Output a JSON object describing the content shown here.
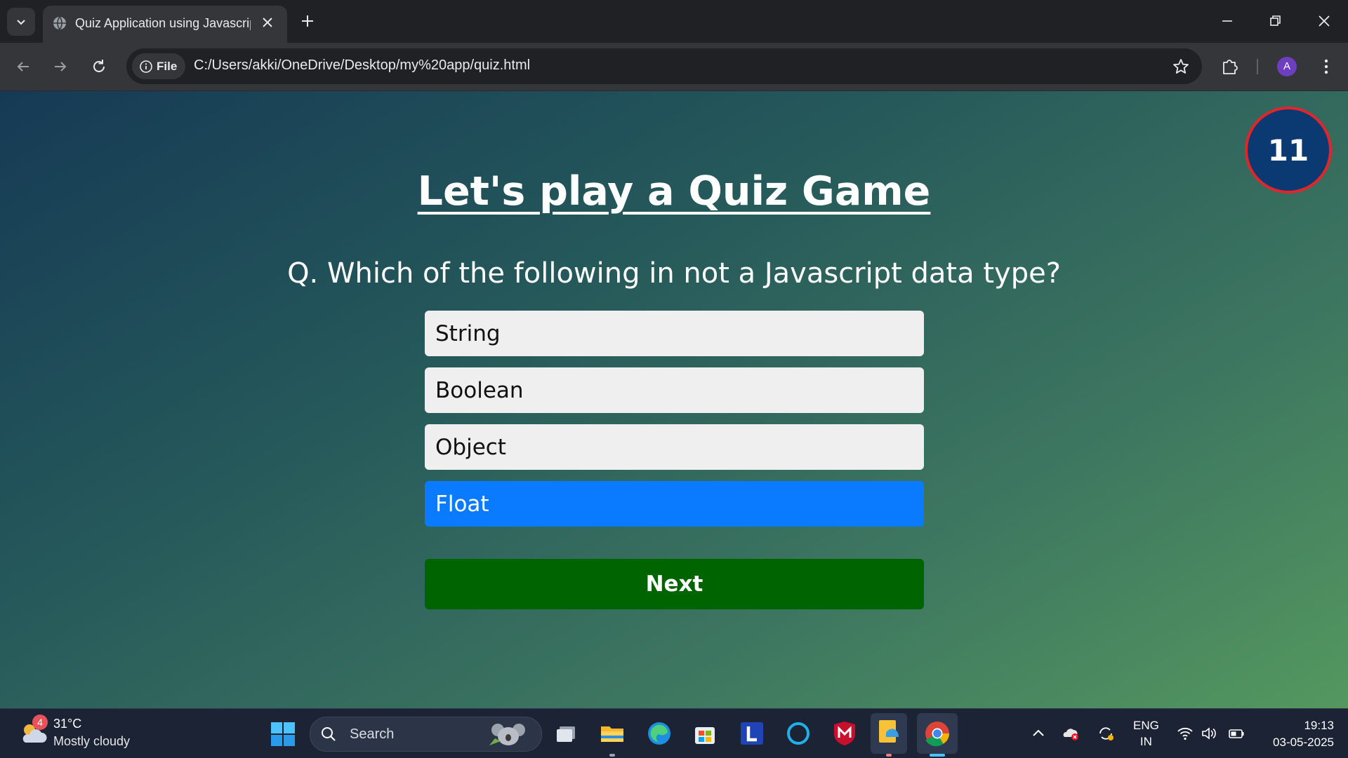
{
  "browser": {
    "tab_title": "Quiz Application using Javascript",
    "site_info_label": "File",
    "url": "C:/Users/akki/OneDrive/Desktop/my%20app/quiz.html",
    "profile_initial": "A"
  },
  "quiz": {
    "timer": "11",
    "heading": "Let's play a Quiz Game",
    "question": "Q. Which of the following in not a Javascript data type?",
    "answers": [
      "String",
      "Boolean",
      "Object",
      "Float"
    ],
    "selected_answer": "Float",
    "next_label": "Next",
    "colors": {
      "answer_default": "#efefef",
      "answer_selected": "#0a7bff",
      "next_button": "#006400",
      "timer_bg": "#0b3a73",
      "timer_border": "#e0262b"
    }
  },
  "taskbar": {
    "weather": {
      "badge": "4",
      "temperature": "31°C",
      "condition": "Mostly cloudy"
    },
    "search_placeholder": "Search",
    "apps": [
      "task-view",
      "file-explorer",
      "edge",
      "microsoft-store",
      "l-app",
      "cortana",
      "mcafee",
      "sticky-app",
      "chrome"
    ],
    "language": {
      "line1": "ENG",
      "line2": "IN"
    },
    "time": "19:13",
    "date": "03-05-2025"
  }
}
